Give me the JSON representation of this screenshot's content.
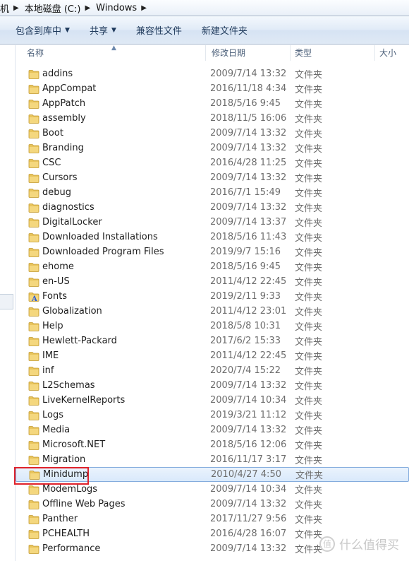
{
  "address": {
    "crumbs": [
      "机",
      "本地磁盘 (C:)",
      "Windows"
    ]
  },
  "toolbar": {
    "include_library": "包含到库中",
    "share": "共享",
    "compat_files": "兼容性文件",
    "new_folder": "新建文件夹"
  },
  "columns": {
    "name": "名称",
    "date": "修改日期",
    "type": "类型",
    "size": "大小"
  },
  "files": [
    {
      "name": "addins",
      "date": "2009/7/14 13:32",
      "type": "文件夹",
      "icon": "folder-icon"
    },
    {
      "name": "AppCompat",
      "date": "2016/11/18 4:34",
      "type": "文件夹",
      "icon": "folder-icon"
    },
    {
      "name": "AppPatch",
      "date": "2018/5/16 9:45",
      "type": "文件夹",
      "icon": "folder-icon"
    },
    {
      "name": "assembly",
      "date": "2018/11/5 16:06",
      "type": "文件夹",
      "icon": "folder-icon"
    },
    {
      "name": "Boot",
      "date": "2009/7/14 13:32",
      "type": "文件夹",
      "icon": "folder-icon"
    },
    {
      "name": "Branding",
      "date": "2009/7/14 13:32",
      "type": "文件夹",
      "icon": "folder-icon"
    },
    {
      "name": "CSC",
      "date": "2016/4/28 11:25",
      "type": "文件夹",
      "icon": "folder-icon"
    },
    {
      "name": "Cursors",
      "date": "2009/7/14 13:32",
      "type": "文件夹",
      "icon": "folder-icon"
    },
    {
      "name": "debug",
      "date": "2016/7/1 15:49",
      "type": "文件夹",
      "icon": "folder-icon"
    },
    {
      "name": "diagnostics",
      "date": "2009/7/14 13:32",
      "type": "文件夹",
      "icon": "folder-icon"
    },
    {
      "name": "DigitalLocker",
      "date": "2009/7/14 13:37",
      "type": "文件夹",
      "icon": "folder-icon"
    },
    {
      "name": "Downloaded Installations",
      "date": "2018/5/16 11:43",
      "type": "文件夹",
      "icon": "folder-icon"
    },
    {
      "name": "Downloaded Program Files",
      "date": "2019/9/7 15:16",
      "type": "文件夹",
      "icon": "folder-icon"
    },
    {
      "name": "ehome",
      "date": "2018/5/16 9:45",
      "type": "文件夹",
      "icon": "folder-icon"
    },
    {
      "name": "en-US",
      "date": "2011/4/12 22:45",
      "type": "文件夹",
      "icon": "folder-icon"
    },
    {
      "name": "Fonts",
      "date": "2019/2/11 9:33",
      "type": "文件夹",
      "icon": "fonts-folder-icon"
    },
    {
      "name": "Globalization",
      "date": "2011/4/12 23:01",
      "type": "文件夹",
      "icon": "folder-icon"
    },
    {
      "name": "Help",
      "date": "2018/5/8 10:31",
      "type": "文件夹",
      "icon": "folder-icon"
    },
    {
      "name": "Hewlett-Packard",
      "date": "2017/6/2 15:33",
      "type": "文件夹",
      "icon": "folder-icon"
    },
    {
      "name": "IME",
      "date": "2011/4/12 22:45",
      "type": "文件夹",
      "icon": "folder-icon"
    },
    {
      "name": "inf",
      "date": "2020/7/4 15:22",
      "type": "文件夹",
      "icon": "folder-icon"
    },
    {
      "name": "L2Schemas",
      "date": "2009/7/14 13:32",
      "type": "文件夹",
      "icon": "folder-icon"
    },
    {
      "name": "LiveKernelReports",
      "date": "2009/7/14 10:34",
      "type": "文件夹",
      "icon": "folder-icon"
    },
    {
      "name": "Logs",
      "date": "2019/3/21 11:12",
      "type": "文件夹",
      "icon": "folder-icon"
    },
    {
      "name": "Media",
      "date": "2009/7/14 13:32",
      "type": "文件夹",
      "icon": "folder-icon"
    },
    {
      "name": "Microsoft.NET",
      "date": "2018/5/16 12:06",
      "type": "文件夹",
      "icon": "folder-icon"
    },
    {
      "name": "Migration",
      "date": "2016/11/17 3:17",
      "type": "文件夹",
      "icon": "folder-icon"
    },
    {
      "name": "Minidump",
      "date": "2010/4/27 4:50",
      "type": "文件夹",
      "icon": "folder-icon",
      "selected": true
    },
    {
      "name": "ModemLogs",
      "date": "2009/7/14 10:34",
      "type": "文件夹",
      "icon": "folder-icon"
    },
    {
      "name": "Offline Web Pages",
      "date": "2009/7/14 13:32",
      "type": "文件夹",
      "icon": "folder-icon"
    },
    {
      "name": "Panther",
      "date": "2017/11/27 9:56",
      "type": "文件夹",
      "icon": "folder-icon"
    },
    {
      "name": "PCHEALTH",
      "date": "2016/4/28 16:07",
      "type": "文件夹",
      "icon": "folder-icon"
    },
    {
      "name": "Performance",
      "date": "2009/7/14 13:32",
      "type": "文件夹",
      "icon": "folder-icon"
    }
  ],
  "colors": {
    "folder": "#e8c45c",
    "selection_border": "#84acdd",
    "annotation_red": "#e0222b"
  },
  "watermark": {
    "badge": "值",
    "text": "什么值得买"
  }
}
